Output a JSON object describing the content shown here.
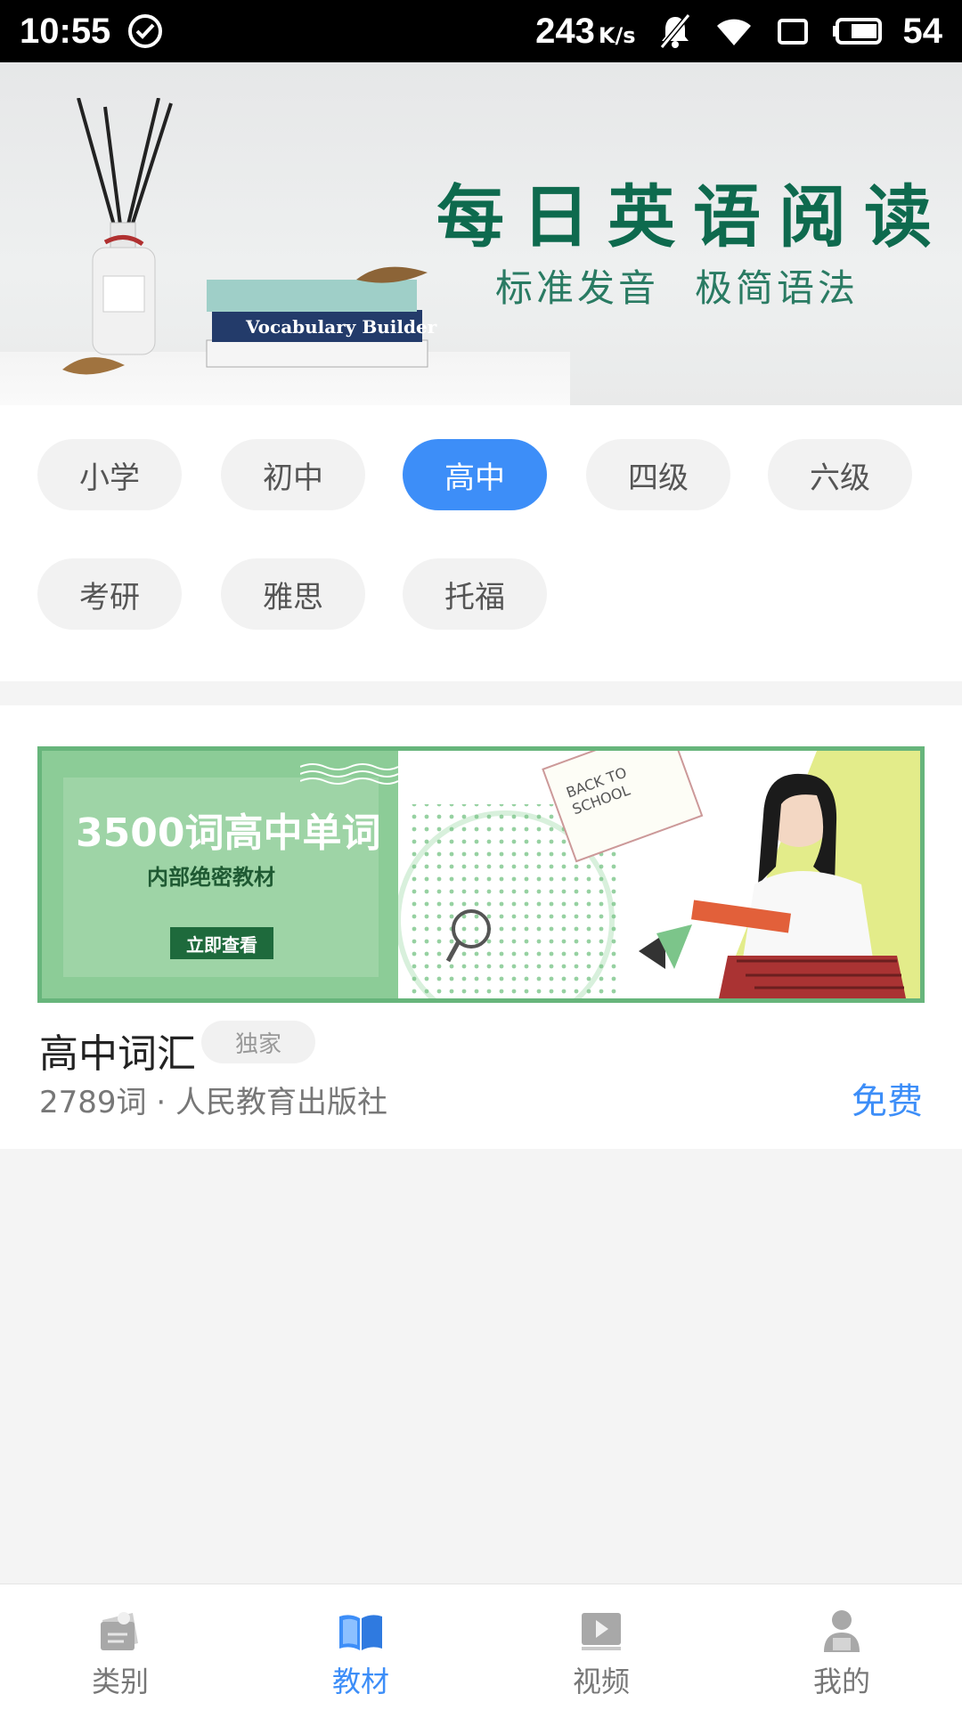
{
  "status_bar": {
    "time": "10:55",
    "net_speed": "243",
    "net_speed_unit": "K/s",
    "battery": "54"
  },
  "hero": {
    "title": "每日英语阅读",
    "subtitle_1": "标准发音",
    "subtitle_2": "极简语法"
  },
  "grades": [
    {
      "label": "小学",
      "active": false
    },
    {
      "label": "初中",
      "active": false
    },
    {
      "label": "高中",
      "active": true
    },
    {
      "label": "四级",
      "active": false
    },
    {
      "label": "六级",
      "active": false
    },
    {
      "label": "考研",
      "active": false
    },
    {
      "label": "雅思",
      "active": false
    },
    {
      "label": "托福",
      "active": false
    }
  ],
  "promo": {
    "headline": "3500词高中单词",
    "subline": "内部绝密教材",
    "button": "立即查看"
  },
  "book": {
    "title": "高中词汇",
    "badge": "独家",
    "meta": "2789词 · 人民教育出版社",
    "price": "免费"
  },
  "tabs": [
    {
      "label": "类别",
      "icon": "category-icon",
      "active": false
    },
    {
      "label": "教材",
      "icon": "book-open-icon",
      "active": true
    },
    {
      "label": "视频",
      "icon": "video-icon",
      "active": false
    },
    {
      "label": "我的",
      "icon": "user-icon",
      "active": false
    }
  ],
  "colors": {
    "accent": "#3d8ef8",
    "hero_title": "#0e6a4e",
    "promo_green": "#8ccc97"
  }
}
